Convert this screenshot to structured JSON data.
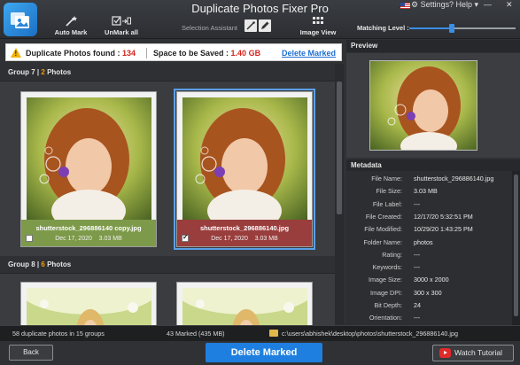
{
  "app": {
    "title": "Duplicate Photos Fixer Pro",
    "settings": "Settings",
    "help": "? Help",
    "win_min": "—",
    "win_close": "✕"
  },
  "toolbar": {
    "auto_mark": "Auto Mark",
    "unmark_all": "UnMark all",
    "selection_assistant": "Selection Assistant",
    "image_view": "Image View",
    "matching_level_label": "Matching Level :",
    "matching_level_fraction": 0.4
  },
  "infobar": {
    "found_label": "Duplicate Photos found :",
    "found_count": "134",
    "space_label": "Space to be Saved :",
    "space_value": "1.40 GB",
    "delete_marked_link": "Delete Marked"
  },
  "groups": [
    {
      "label": "Group 7",
      "sep": "|",
      "count": "2",
      "count_label": "Photos",
      "photos": [
        {
          "filename": "shutterstock_296886140 copy.jpg",
          "date": "Dec 17, 2020",
          "size": "3.03 MB",
          "checked": false,
          "status_color": "#7d9a4a"
        },
        {
          "filename": "shutterstock_296886140.jpg",
          "date": "Dec 17, 2020",
          "size": "3.03 MB",
          "checked": true,
          "status_color": "#9a3d3d"
        }
      ]
    },
    {
      "label": "Group 8",
      "sep": "|",
      "count": "6",
      "count_label": "Photos"
    }
  ],
  "preview": {
    "title": "Preview"
  },
  "metadata": {
    "title": "Metadata",
    "rows": [
      {
        "key": "File Name:",
        "value": "shutterstock_296886140.jpg"
      },
      {
        "key": "File Size:",
        "value": "3.03 MB"
      },
      {
        "key": "File Label:",
        "value": "---"
      },
      {
        "key": "File Created:",
        "value": "12/17/20 5:32:51 PM"
      },
      {
        "key": "File Modified:",
        "value": "10/29/20 1:43:25 PM"
      },
      {
        "key": "Folder Name:",
        "value": "photos"
      },
      {
        "key": "Rating:",
        "value": "---"
      },
      {
        "key": "Keywords:",
        "value": "---"
      },
      {
        "key": "Image Size:",
        "value": "3000 x 2000"
      },
      {
        "key": "Image DPI:",
        "value": "300 x 300"
      },
      {
        "key": "Bit Depth:",
        "value": "24"
      },
      {
        "key": "Orientation:",
        "value": "---"
      }
    ]
  },
  "status": {
    "groups_text": "58 duplicate photos in 15 groups",
    "marked_text": "43 Marked (435 MB)",
    "path_text": "c:\\users\\abhishek\\desktop\\photos\\shutterstock_296886140.jpg"
  },
  "bottom": {
    "back": "Back",
    "delete_marked": "Delete Marked",
    "watch_tutorial": "Watch Tutorial"
  },
  "colors": {
    "accent": "#1f7fe0",
    "warning": "#d6241d",
    "group_count": "#f39c12"
  }
}
